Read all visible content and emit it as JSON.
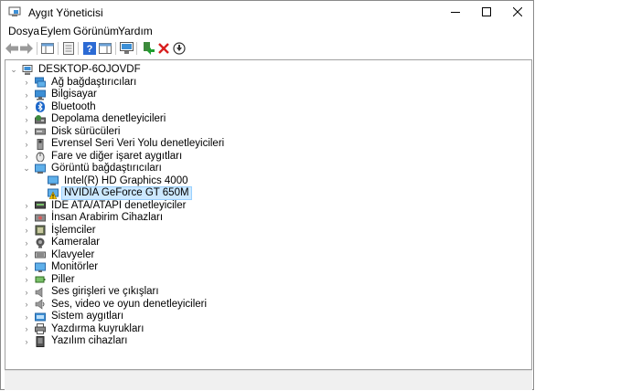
{
  "window": {
    "title": "Aygıt Yöneticisi"
  },
  "menu": [
    "Dosya",
    "Eylem",
    "Görünüm",
    "Yardım"
  ],
  "tree": {
    "root": "DESKTOP-6OJOVDF",
    "categories": [
      {
        "label": "Ağ bağdaştırıcıları",
        "icon": "network-icon"
      },
      {
        "label": "Bilgisayar",
        "icon": "computer-icon"
      },
      {
        "label": "Bluetooth",
        "icon": "bluetooth-icon"
      },
      {
        "label": "Depolama denetleyicileri",
        "icon": "storage-icon"
      },
      {
        "label": "Disk sürücüleri",
        "icon": "disk-icon"
      },
      {
        "label": "Evrensel Seri Veri Yolu denetleyicileri",
        "icon": "usb-icon"
      },
      {
        "label": "Fare ve diğer işaret aygıtları",
        "icon": "mouse-icon"
      },
      {
        "label": "Görüntü bağdaştırıcıları",
        "icon": "display-icon",
        "expanded": true,
        "children": [
          {
            "label": "Intel(R) HD Graphics 4000",
            "icon": "display-adapter-icon"
          },
          {
            "label": "NVIDIA GeForce GT 650M",
            "icon": "warning-display-icon",
            "selected": true
          }
        ]
      },
      {
        "label": "IDE ATA/ATAPI denetleyiciler",
        "icon": "ide-icon"
      },
      {
        "label": "İnsan Arabirim Cihazları",
        "icon": "hid-icon"
      },
      {
        "label": "İşlemciler",
        "icon": "cpu-icon"
      },
      {
        "label": "Kameralar",
        "icon": "camera-icon"
      },
      {
        "label": "Klavyeler",
        "icon": "keyboard-icon"
      },
      {
        "label": "Monitörler",
        "icon": "monitor-icon"
      },
      {
        "label": "Piller",
        "icon": "battery-icon"
      },
      {
        "label": "Ses girişleri ve çıkışları",
        "icon": "speaker-icon"
      },
      {
        "label": "Ses, video ve oyun denetleyicileri",
        "icon": "sound-icon"
      },
      {
        "label": "Sistem aygıtları",
        "icon": "system-icon"
      },
      {
        "label": "Yazdırma kuyrukları",
        "icon": "printer-icon"
      },
      {
        "label": "Yazılım cihazları",
        "icon": "software-device-icon"
      }
    ]
  }
}
